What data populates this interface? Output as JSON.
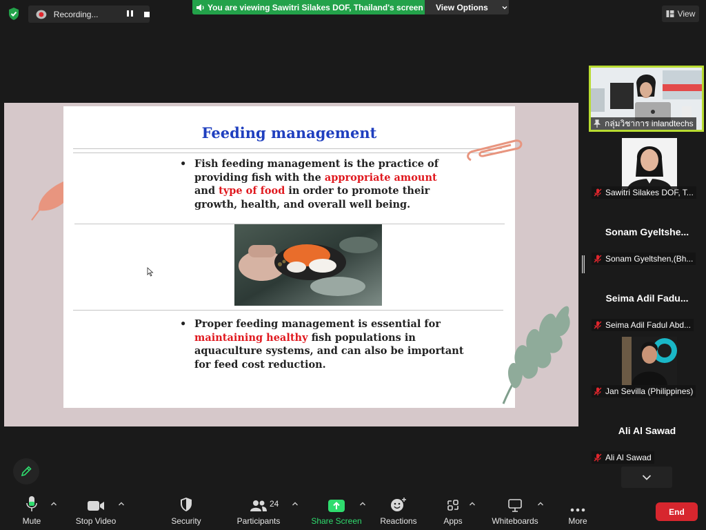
{
  "top_bar": {
    "recording_label": "Recording...",
    "viewing_banner": "You are viewing Sawitri Silakes DOF, Thailand's screen",
    "view_options_label": "View Options",
    "view_label": "View"
  },
  "slide": {
    "title": "Feeding management",
    "bullet1": {
      "part1": "Fish feeding management is the practice of providing fish with the ",
      "highlight1": "appropriate amount",
      "part2": " and ",
      "highlight2": "type of food",
      "part3": " in order to promote their growth, health, and overall well being."
    },
    "bullet2": {
      "highlight1": "maintaining healthy",
      "part0": "Proper feeding management is essential for ",
      "part1": " fish populations in aquaculture systems, and can also be important for feed cost reduction."
    },
    "bullet_char": "•"
  },
  "participants": [
    {
      "name": "กลุ่มวิชาการ inlandtechs",
      "video": true,
      "active": true
    },
    {
      "name": "Sawitri Silakes DOF, T...",
      "video": true
    },
    {
      "name": "Sonam Gyeltshen,(Bh...",
      "display": "Sonam  Gyeltshe...",
      "video": false
    },
    {
      "name": "Seima Adil Fadul Abd...",
      "display": "Seima  Adil  Fadu...",
      "video": false
    },
    {
      "name": "Jan Sevilla (Philippines)",
      "video": true
    },
    {
      "name": "Ali Al Sawad",
      "display": "Ali Al Sawad",
      "video": false
    }
  ],
  "toolbar": {
    "mute": "Mute",
    "stop_video": "Stop Video",
    "security": "Security",
    "participants": "Participants",
    "participants_count": "24",
    "share_screen": "Share Screen",
    "reactions": "Reactions",
    "apps": "Apps",
    "whiteboards": "Whiteboards",
    "more": "More",
    "end": "End"
  },
  "colors": {
    "banner_green": "#23a24a",
    "active_speaker": "#b9dc31",
    "end_red": "#d7262e",
    "title_blue": "#1f3fbf",
    "highlight_red": "#e0191f"
  }
}
